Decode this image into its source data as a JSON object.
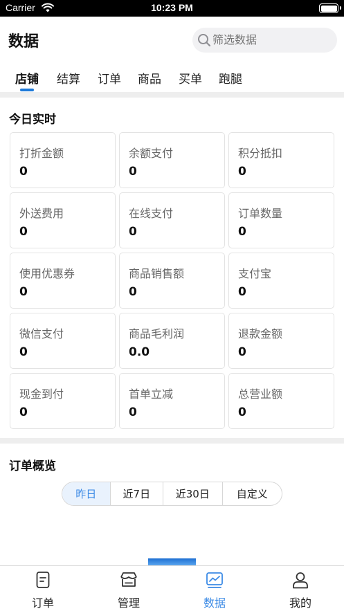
{
  "status_bar": {
    "carrier": "Carrier",
    "time": "10:23 PM"
  },
  "header": {
    "title": "数据",
    "search": {
      "placeholder": "筛选数据",
      "value": ""
    }
  },
  "tabs": [
    {
      "label": "店铺",
      "active": true
    },
    {
      "label": "结算",
      "active": false
    },
    {
      "label": "订单",
      "active": false
    },
    {
      "label": "商品",
      "active": false
    },
    {
      "label": "买单",
      "active": false
    },
    {
      "label": "跑腿",
      "active": false
    }
  ],
  "today": {
    "title": "今日实时",
    "stats": [
      {
        "label": "打折金额",
        "value": "0"
      },
      {
        "label": "余额支付",
        "value": "0"
      },
      {
        "label": "积分抵扣",
        "value": "0"
      },
      {
        "label": "外送费用",
        "value": "0"
      },
      {
        "label": "在线支付",
        "value": "0"
      },
      {
        "label": "订单数量",
        "value": "0"
      },
      {
        "label": "使用优惠券",
        "value": "0"
      },
      {
        "label": "商品销售额",
        "value": "0"
      },
      {
        "label": "支付宝",
        "value": "0"
      },
      {
        "label": "微信支付",
        "value": "0"
      },
      {
        "label": "商品毛利润",
        "value": "0.0"
      },
      {
        "label": "退款金额",
        "value": "0"
      },
      {
        "label": "现金到付",
        "value": "0"
      },
      {
        "label": "首单立减",
        "value": "0"
      },
      {
        "label": "总营业额",
        "value": "0"
      }
    ]
  },
  "overview": {
    "title": "订单概览",
    "ranges": [
      {
        "label": "昨日",
        "active": true
      },
      {
        "label": "近7日",
        "active": false
      },
      {
        "label": "近30日",
        "active": false
      },
      {
        "label": "自定义",
        "active": false
      }
    ]
  },
  "tabbar": {
    "items": [
      {
        "label": "订单",
        "icon": "order-icon",
        "active": false
      },
      {
        "label": "管理",
        "icon": "store-icon",
        "active": false
      },
      {
        "label": "数据",
        "icon": "chart-icon",
        "active": true
      },
      {
        "label": "我的",
        "icon": "user-icon",
        "active": false
      }
    ]
  },
  "colors": {
    "accent": "#3b8ae5",
    "accent_bg": "#e9f2fd",
    "divider": "#eeeeee"
  }
}
